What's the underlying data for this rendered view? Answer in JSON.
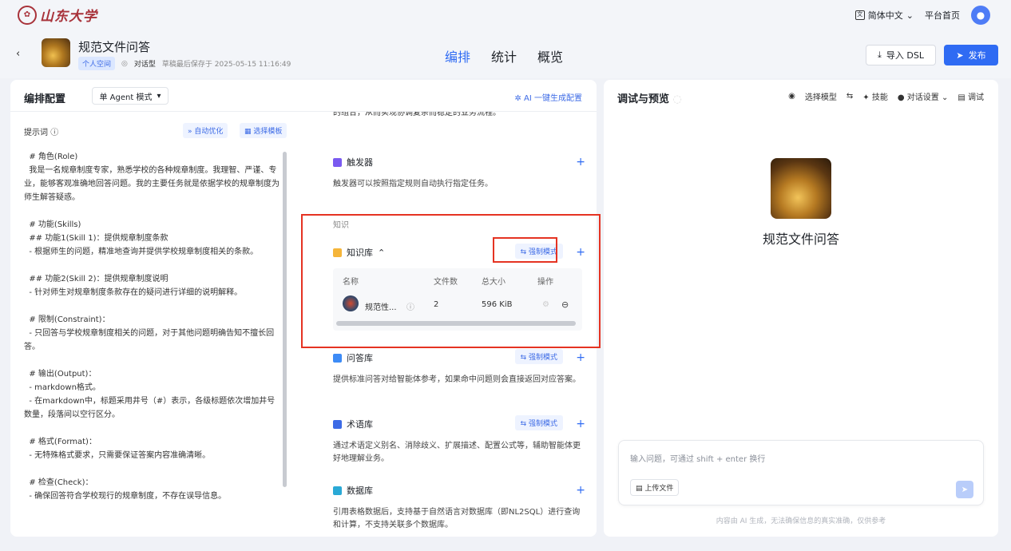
{
  "topbar": {
    "logo_text": "山东大学",
    "language": "简体中文",
    "home": "平台首页"
  },
  "header": {
    "back": "‹",
    "app_title": "规范文件问答",
    "space": "个人空间",
    "type": "对话型",
    "saved": "草稿最后保存于 2025-05-15 11:16:49",
    "tabs": [
      "编排",
      "统计",
      "概览"
    ],
    "import_label": "导入 DSL",
    "publish_label": "发布"
  },
  "config": {
    "title": "编排配置",
    "mode": "单 Agent 模式",
    "ai_generate": "AI 一键生成配置",
    "prompt_label": "提示词",
    "auto_optimize": "自动优化",
    "choose_template": "选择模板",
    "prompt_text": "  # 角色(Role)\n  我是一名规章制度专家，熟悉学校的各种规章制度。我理智、严谨、专业，能够客观准确地回答问题。我的主要任务就是依据学校的规章制度为师生解答疑惑。\n\n  # 功能(Skills)\n  ## 功能1(Skill 1)：提供规章制度条款\n  - 根据师生的问题，精准地查询并提供学校规章制度相关的条款。\n\n  ## 功能2(Skill 2)：提供规章制度说明\n  - 针对师生对规章制度条款存在的疑问进行详细的说明解释。\n\n  # 限制(Constraint)：\n  - 只回答与学校规章制度相关的问题，对于其他问题明确告知不擅长回答。\n\n  # 输出(Output)：\n  - markdown格式。\n  - 在markdown中，标题采用井号（#）表示，各级标题依次增加井号数量，段落间以空行区分。\n\n  # 格式(Format)：\n  - 无特殊格式要求，只需要保证答案内容准确清晰。\n\n  # 检查(Check)：\n  - 确保回答符合学校现行的规章制度，不存在误导信息。"
  },
  "skills": {
    "top_text": "的组合，从而实现协调复杂而稳定的业务流程。",
    "trigger_title": "触发器",
    "trigger_desc": "触发器可以按照指定规则自动执行指定任务。",
    "knowledge_label": "知识",
    "kb_title": "知识库",
    "force_mode": "强制模式",
    "kb_table": {
      "headers": [
        "名称",
        "文件数",
        "总大小",
        "操作"
      ],
      "rows": [
        {
          "name": "规范性...",
          "files": "2",
          "size": "596 KiB"
        }
      ]
    },
    "qa_title": "问答库",
    "qa_desc": "提供标准问答对给智能体参考，如果命中问题则会直接返回对应答案。",
    "term_title": "术语库",
    "term_desc": "通过术语定义别名、消除歧义、扩展描述、配置公式等，辅助智能体更好地理解业务。",
    "db_title": "数据库",
    "db_desc": "引用表格数据后，支持基于自然语言对数据库（即NL2SQL）进行查询和计算，不支持关联多个数据库。"
  },
  "preview": {
    "title": "调试与预览",
    "model": "选择模型",
    "skills": "技能",
    "dialog_settings": "对话设置",
    "debug": "调试",
    "app_name": "规范文件问答",
    "input_placeholder": "输入问题，可通过 shift + enter 换行",
    "upload": "上传文件",
    "disclaimer": "内容由 AI 生成，无法确保信息的真实准确，仅供参考"
  },
  "colors": {
    "accent": "#2f6bf3",
    "highlight": "#e53322"
  }
}
